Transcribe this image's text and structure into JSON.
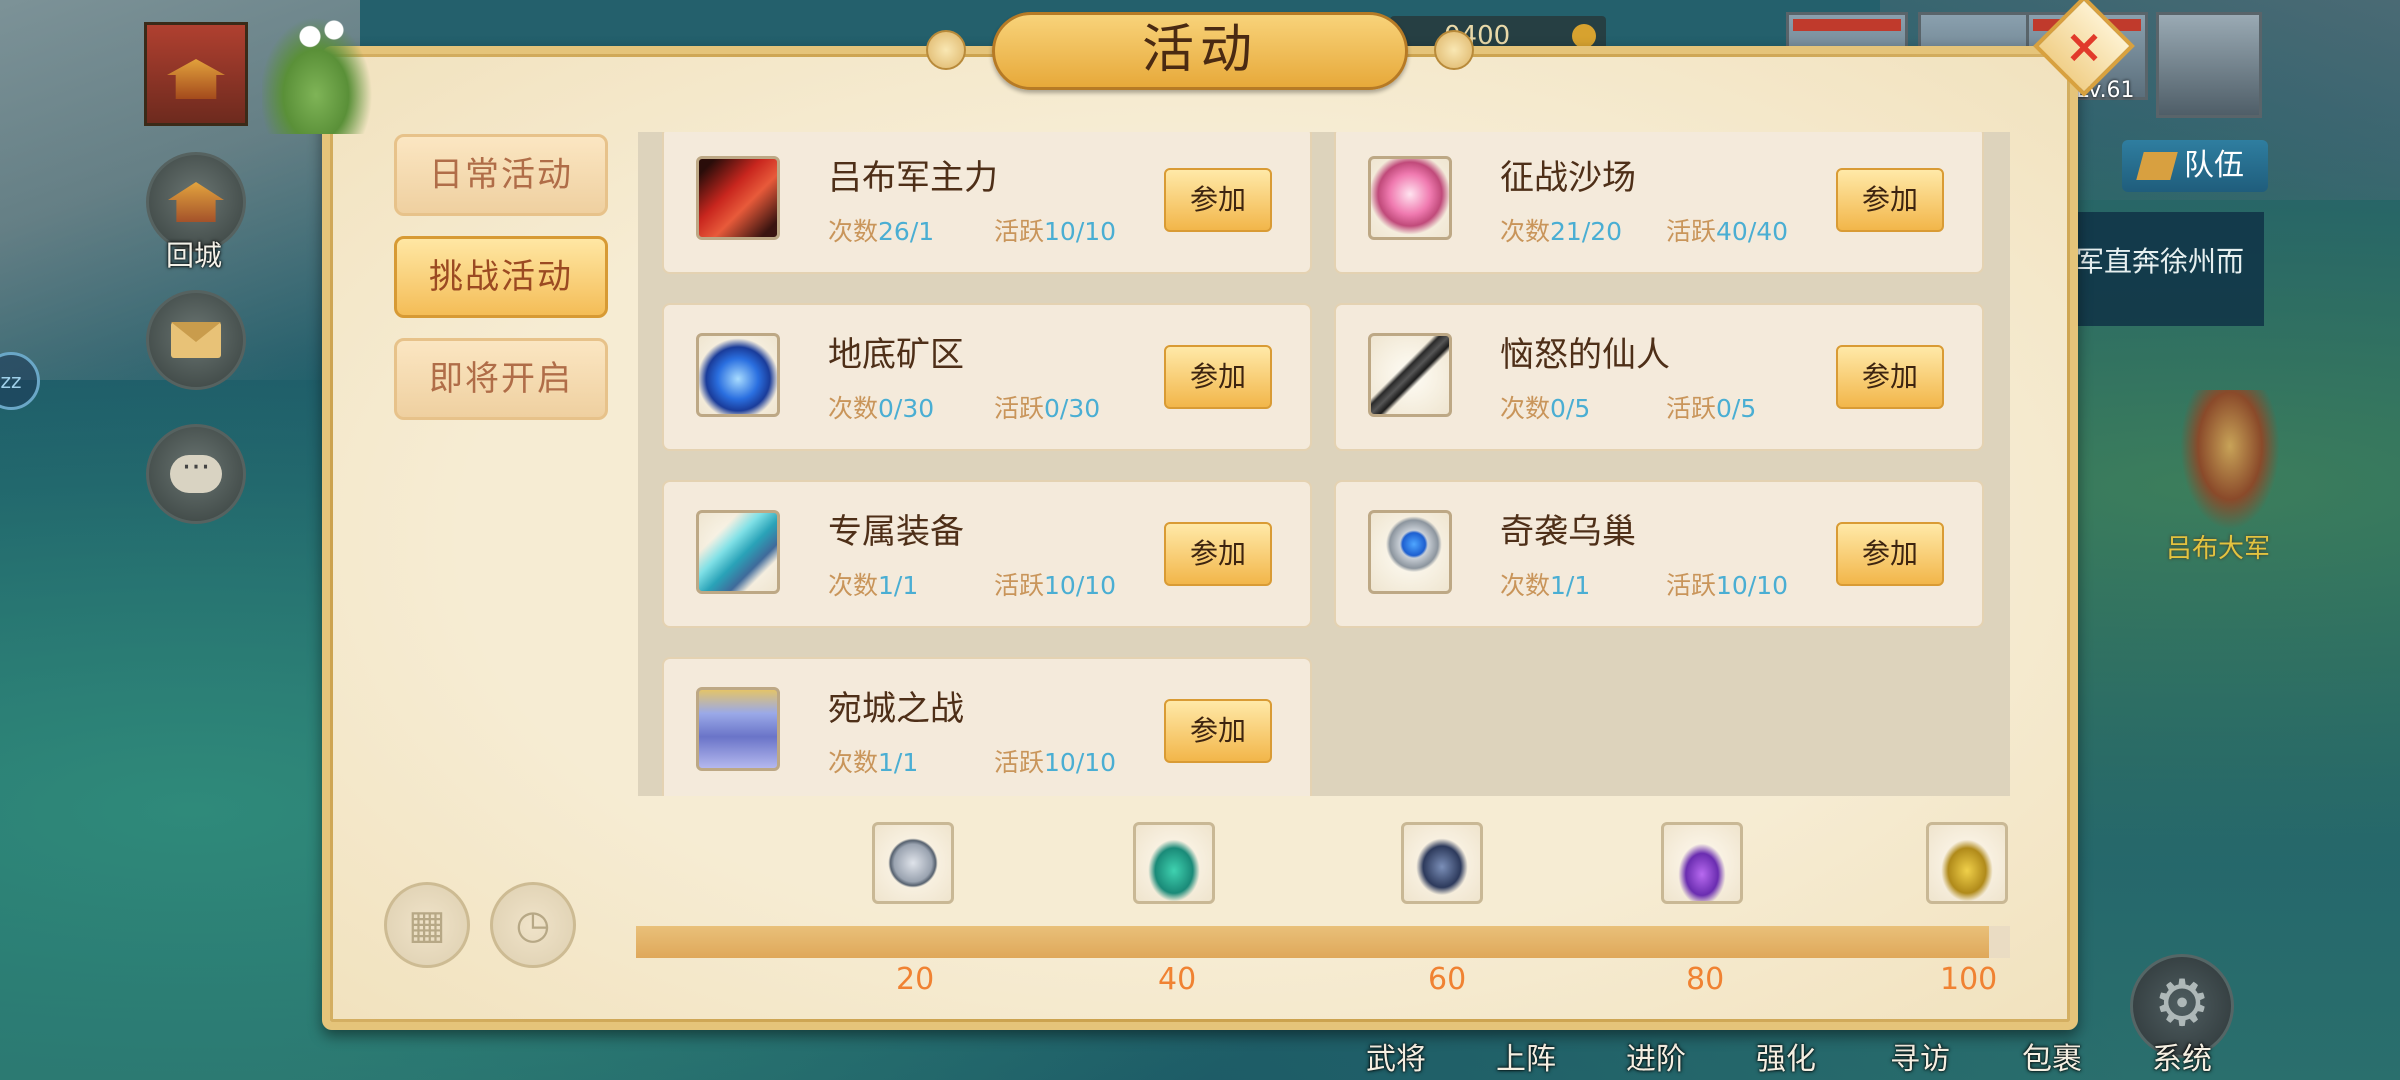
{
  "hud": {
    "return_city_label": "回城",
    "gold_value": "0400",
    "level_label": "Lv.61",
    "team_label": "队伍",
    "quest_text": "军直奔徐州而",
    "enemy_name": "吕布大军",
    "bottom_menu": [
      "武将",
      "上阵",
      "进阶",
      "强化",
      "寻访",
      "包裹",
      "系统"
    ]
  },
  "dialog": {
    "title": "活动",
    "close_label": "×",
    "tabs": [
      {
        "label": "日常活动",
        "active": false
      },
      {
        "label": "挑战活动",
        "active": true
      },
      {
        "label": "即将开启",
        "active": false
      }
    ],
    "count_label": "次数",
    "activity_label": "活跃",
    "join_label": "参加",
    "activities": [
      {
        "name": "吕布军主力",
        "count": "26/1",
        "activity": "10/10",
        "icon": "red-axe-icon"
      },
      {
        "name": "征战沙场",
        "count": "21/20",
        "activity": "40/40",
        "icon": "pink-lotus-icon"
      },
      {
        "name": "地底矿区",
        "count": "0/30",
        "activity": "0/30",
        "icon": "blue-crystal-icon"
      },
      {
        "name": "恼怒的仙人",
        "count": "0/5",
        "activity": "0/5",
        "icon": "dark-sword-icon"
      },
      {
        "name": "专属装备",
        "count": "1/1",
        "activity": "10/10",
        "icon": "jade-blade-icon"
      },
      {
        "name": "奇袭乌巢",
        "count": "1/1",
        "activity": "10/10",
        "icon": "sapphire-ring-icon"
      },
      {
        "name": "宛城之战",
        "count": "1/1",
        "activity": "10/10",
        "icon": "purple-robe-icon"
      }
    ],
    "rewards": [
      {
        "milestone": "20",
        "icon": "silver-coin-icon"
      },
      {
        "milestone": "40",
        "icon": "jade-pendant-icon"
      },
      {
        "milestone": "60",
        "icon": "dark-crystal-icon"
      },
      {
        "milestone": "80",
        "icon": "potion-icon"
      },
      {
        "milestone": "100",
        "icon": "gold-pendant-icon"
      }
    ],
    "progress_fraction": 0.985
  }
}
